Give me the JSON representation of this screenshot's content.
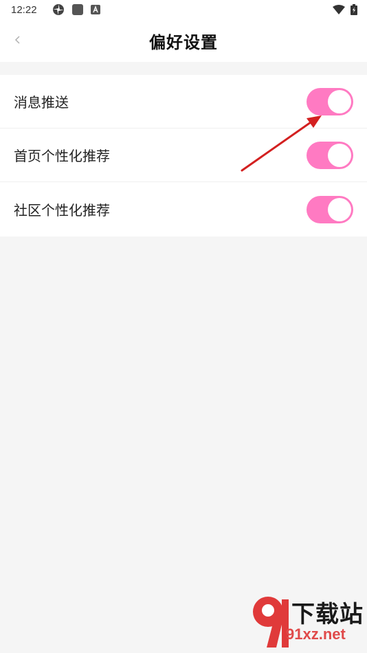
{
  "status_bar": {
    "time": "12:22",
    "left_icons": [
      "pinwheel-icon",
      "square-app-icon",
      "a-app-icon"
    ],
    "right_icons": [
      "wifi-icon",
      "battery-icon"
    ]
  },
  "nav": {
    "title": "偏好设置",
    "back_icon": "chevron-left-icon"
  },
  "settings": [
    {
      "label": "消息推送",
      "enabled": true
    },
    {
      "label": "首页个性化推荐",
      "enabled": true
    },
    {
      "label": "社区个性化推荐",
      "enabled": true
    }
  ],
  "colors": {
    "toggle_on": "#ff7ac2",
    "background": "#f5f5f5",
    "arrow": "#d32020"
  },
  "watermark": {
    "brand": "下载站",
    "url": "91xz.net",
    "logo_text": "91"
  }
}
